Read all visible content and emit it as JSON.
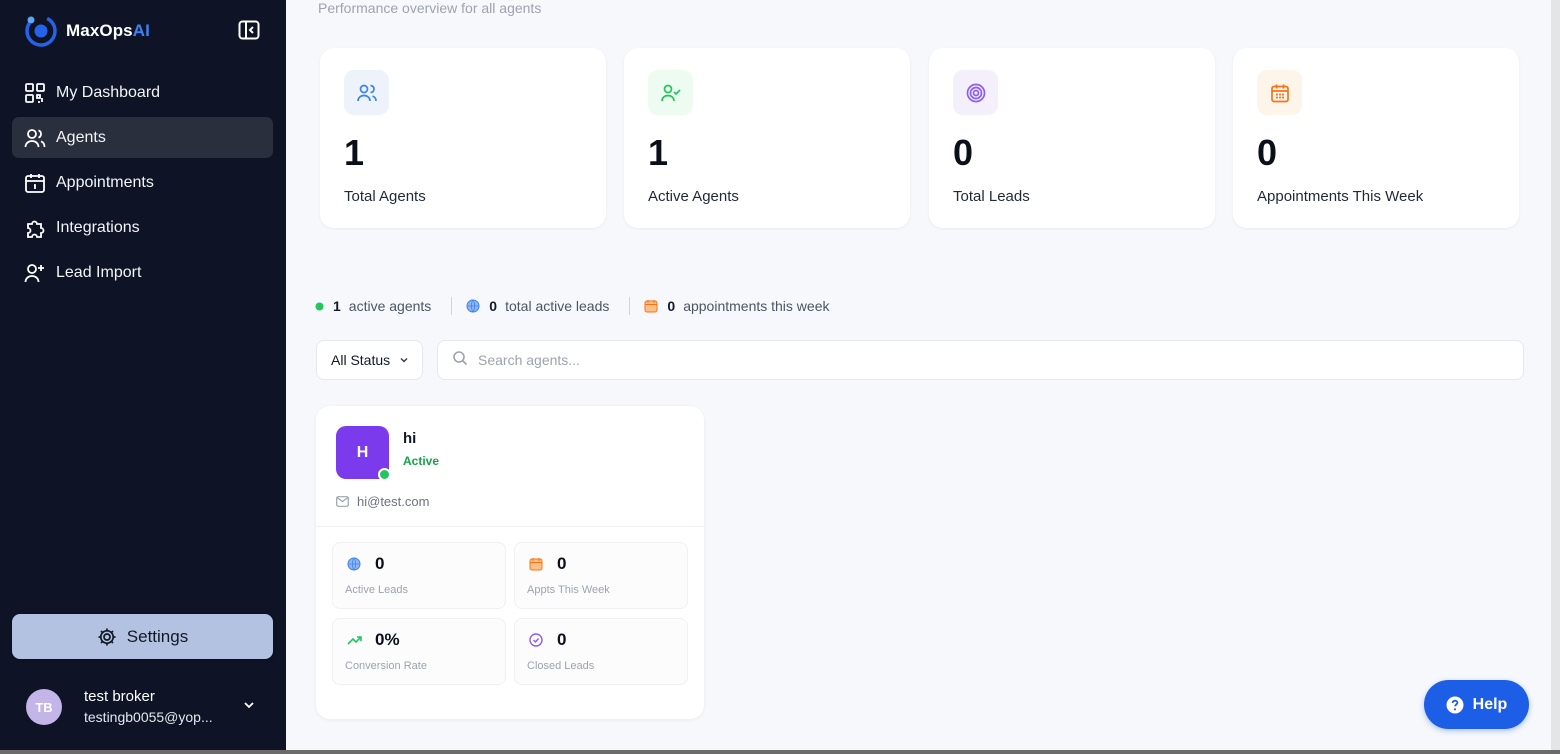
{
  "app": {
    "name_main": "MaxOps",
    "name_accent": "AI"
  },
  "sidebar": {
    "items": [
      {
        "label": "My Dashboard",
        "icon": "dashboard-icon",
        "active": false
      },
      {
        "label": "Agents",
        "icon": "users-icon",
        "active": true
      },
      {
        "label": "Appointments",
        "icon": "calendar-icon",
        "active": false
      },
      {
        "label": "Integrations",
        "icon": "puzzle-icon",
        "active": false
      },
      {
        "label": "Lead Import",
        "icon": "user-plus-icon",
        "active": false
      }
    ],
    "settings_label": "Settings",
    "user": {
      "initials": "TB",
      "name": "test broker",
      "email": "testingb0055@yop..."
    }
  },
  "header": {
    "subtitle": "Performance overview for all agents"
  },
  "stats": [
    {
      "value": "1",
      "label": "Total Agents",
      "icon": "users-icon",
      "color": "#3b82f6"
    },
    {
      "value": "1",
      "label": "Active Agents",
      "icon": "user-check-icon",
      "color": "#22c55e"
    },
    {
      "value": "0",
      "label": "Total Leads",
      "icon": "target-icon",
      "color": "#8b5cf6"
    },
    {
      "value": "0",
      "label": "Appointments This Week",
      "icon": "calendar-icon",
      "color": "#f97316"
    }
  ],
  "summary": {
    "active_agents_count": "1",
    "active_agents_label": "active agents",
    "leads_count": "0",
    "leads_label": "total active leads",
    "appts_count": "0",
    "appts_label": "appointments this week"
  },
  "filters": {
    "status_value": "All Status",
    "search_placeholder": "Search agents..."
  },
  "agent": {
    "initial": "H",
    "name": "hi",
    "status": "Active",
    "email": "hi@test.com",
    "metrics": [
      {
        "value": "0",
        "label": "Active Leads",
        "icon": "globe-icon"
      },
      {
        "value": "0",
        "label": "Appts This Week",
        "icon": "calendar-icon"
      },
      {
        "value": "0%",
        "label": "Conversion Rate",
        "icon": "trending-up-icon"
      },
      {
        "value": "0",
        "label": "Closed Leads",
        "icon": "check-circle-icon"
      }
    ]
  },
  "help_label": "Help"
}
